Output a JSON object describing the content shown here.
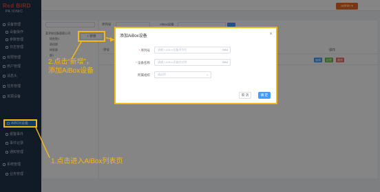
{
  "brand": {
    "logo_line1": "Red BIRD",
    "logo_line2": "PA IONIC"
  },
  "topbar": {
    "user_button": "admin ▾"
  },
  "sidebar": {
    "items": [
      {
        "label": "设备管理",
        "level": 1
      },
      {
        "label": "设备操作",
        "level": 2
      },
      {
        "label": "参数管理",
        "level": 2
      },
      {
        "label": "日志管理",
        "level": 2
      },
      {
        "label": "有限管理",
        "level": 1
      },
      {
        "label": "用户管理",
        "level": 1
      },
      {
        "label": "消息头",
        "level": 1
      },
      {
        "label": "任务管理",
        "level": 1
      },
      {
        "label": "资源设备",
        "level": 1
      },
      {
        "label": "AiBOX设备",
        "level": 2,
        "active": true
      },
      {
        "label": "报警事件",
        "level": 2
      },
      {
        "label": "事件记录",
        "level": 2
      },
      {
        "label": "通知管理",
        "level": 2
      },
      {
        "label": "系统管理",
        "level": 1
      },
      {
        "label": "业务管理",
        "level": 2
      }
    ]
  },
  "background": {
    "add_button": "+ 新增",
    "filter": {
      "serial_label": "序列号",
      "name_label": "AiBox设备"
    },
    "tree": [
      "某学校设备管理公司",
      "研究院1",
      "测试部",
      "研发部",
      "部1"
    ],
    "table": {
      "index_header": "序号",
      "action_header": "操作"
    },
    "row_actions": [
      "编辑",
      "配置",
      "删除"
    ]
  },
  "dialog": {
    "title": "添加AiBox设备",
    "close_icon": "close-icon",
    "fields": [
      {
        "label": "序列号",
        "required": true,
        "placeholder": "请输入AiBox设备序列号",
        "counter": "0/64"
      },
      {
        "label": "设备名称",
        "required": true,
        "placeholder": "请输入AiBox设备的名称",
        "counter": "0/64"
      },
      {
        "label": "所属组织",
        "required": false,
        "placeholder": "请选择",
        "chevron": "chevron-down-icon"
      }
    ],
    "cancel_label": "取 消",
    "confirm_label": "确 定"
  },
  "annotations": {
    "step2_line1": "2.点击“新增”，",
    "step2_line2": "添加AiBox设备",
    "step1": "1.点击进入AiBox列表页",
    "accent_color": "#f2b81a"
  }
}
